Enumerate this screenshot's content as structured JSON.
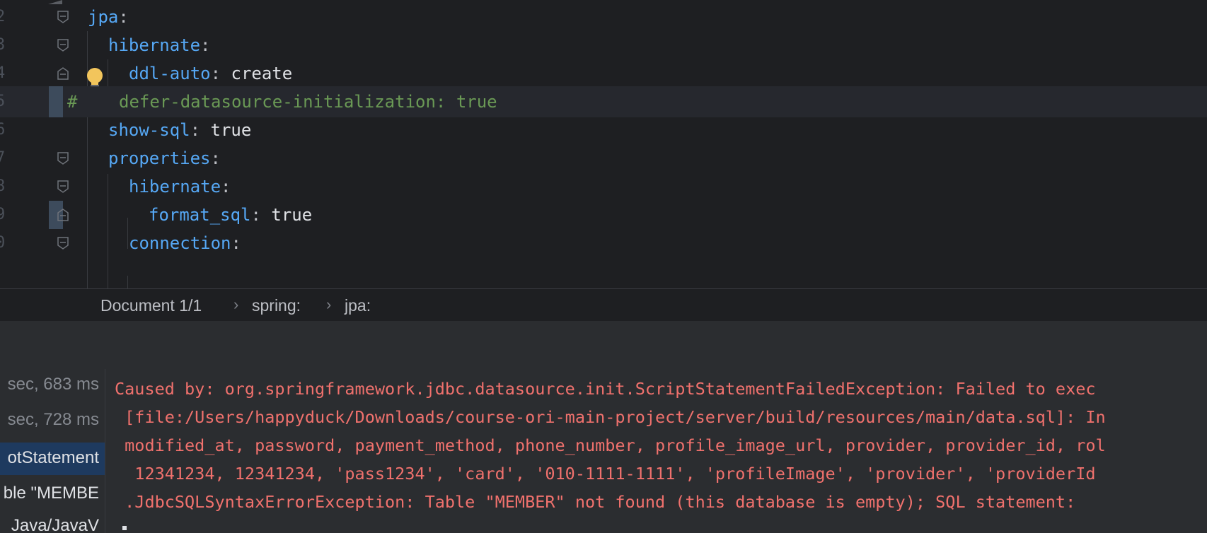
{
  "editor": {
    "line_numbers": [
      "2",
      "3",
      "4",
      "5",
      "6",
      "7",
      "8",
      "9",
      "0"
    ],
    "lines": [
      {
        "key": "jpa",
        "colon": ":",
        "value": ""
      },
      {
        "key": "hibernate",
        "colon": ":",
        "value": ""
      },
      {
        "key": "ddl-auto",
        "colon": ":",
        "value": " create"
      },
      {
        "comment_hash": "#",
        "comment_text": "defer-datasource-initialization: true"
      },
      {
        "key": "show-sql",
        "colon": ":",
        "value": " true"
      },
      {
        "key": "properties",
        "colon": ":",
        "value": ""
      },
      {
        "key": "hibernate",
        "colon": ":",
        "value": ""
      },
      {
        "key": "format_sql",
        "colon": ":",
        "value": " true"
      },
      {
        "key": "connection",
        "colon": ":",
        "value": ""
      }
    ]
  },
  "breadcrumb": {
    "items": [
      "Document 1/1",
      "spring:",
      "jpa:"
    ],
    "separator": "›"
  },
  "run": {
    "tree": [
      {
        "text": "sec, 683 ms"
      },
      {
        "text": "sec, 728 ms"
      },
      {
        "text": "otStatement"
      },
      {
        "text": "ble \"MEMBE"
      },
      {
        "text": "Java/JavaV"
      }
    ],
    "console_lines": [
      "Caused by: org.springframework.jdbc.datasource.init.ScriptStatementFailedException: Failed to exec",
      " [file:/Users/happyduck/Downloads/course-ori-main-project/server/build/resources/main/data.sql]: In",
      " modified_at, password, payment_method, phone_number, profile_image_url, provider, provider_id, rol",
      "  12341234, 12341234, 'pass1234', 'card', '010-1111-1111', 'profileImage', 'provider', 'providerId",
      " .JdbcSQLSyntaxErrorException: Table \"MEMBER\" not found (this database is empty); SQL statement:"
    ]
  },
  "colors": {
    "key": "#56a8f5",
    "comment": "#6a9955",
    "error": "#f0716d",
    "bulb": "#f2c55c"
  }
}
